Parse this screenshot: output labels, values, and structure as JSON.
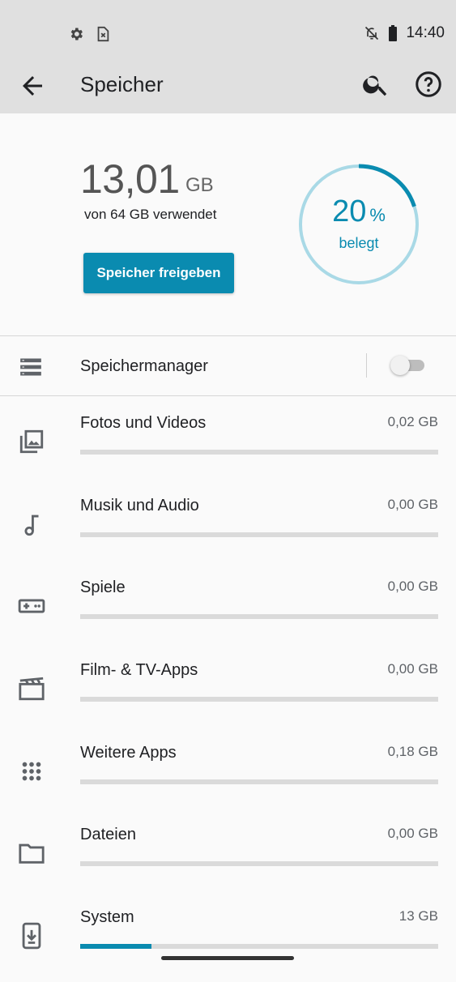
{
  "status_bar": {
    "time": "14:40",
    "icons": [
      "settings-icon",
      "sim-error-icon",
      "notifications-off-icon",
      "battery-icon"
    ]
  },
  "app_bar": {
    "title": "Speicher",
    "icons": [
      "back-arrow-icon",
      "search-icon",
      "help-icon"
    ]
  },
  "summary": {
    "used_value": "13,01",
    "used_unit": "GB",
    "used_subtitle": "von 64 GB verwendet",
    "free_button_label": "Speicher freigeben",
    "percent_value": "20",
    "percent_symbol": "%",
    "percent_label": "belegt",
    "percent_fraction": 0.2
  },
  "storage_manager": {
    "label": "Speichermanager",
    "enabled": false
  },
  "categories": [
    {
      "label": "Fotos und Videos",
      "size": "0,02 GB",
      "fill": 0.0,
      "icon": "photo-library-icon"
    },
    {
      "label": "Musik und Audio",
      "size": "0,00 GB",
      "fill": 0.0,
      "icon": "music-note-icon"
    },
    {
      "label": "Spiele",
      "size": "0,00 GB",
      "fill": 0.0,
      "icon": "gamepad-icon"
    },
    {
      "label": "Film- & TV-Apps",
      "size": "0,00 GB",
      "fill": 0.0,
      "icon": "movie-icon"
    },
    {
      "label": "Weitere Apps",
      "size": "0,18 GB",
      "fill": 0.0,
      "icon": "apps-grid-icon"
    },
    {
      "label": "Dateien",
      "size": "0,00 GB",
      "fill": 0.0,
      "icon": "folder-icon"
    },
    {
      "label": "System",
      "size": "13 GB",
      "fill": 0.2,
      "icon": "system-update-icon"
    }
  ],
  "colors": {
    "accent": "#0a8bb0",
    "ring_track": "#a9d9e6",
    "bar_track": "#dadada",
    "app_bar_bg": "#e0e0e0"
  }
}
